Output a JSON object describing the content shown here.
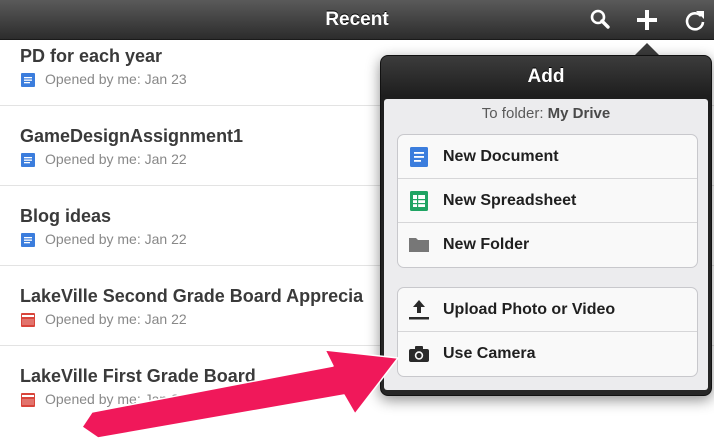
{
  "header": {
    "title": "Recent",
    "buttons": [
      {
        "name": "search-icon"
      },
      {
        "name": "plus-icon"
      },
      {
        "name": "refresh-icon"
      }
    ]
  },
  "documents": [
    {
      "title": "PD for each year",
      "meta": "Opened by me: Jan 23",
      "type": "document",
      "color": "#3b7ddd"
    },
    {
      "title": "GameDesignAssignment1",
      "meta": "Opened by me: Jan 22",
      "type": "document",
      "color": "#3b7ddd"
    },
    {
      "title": "Blog ideas",
      "meta": "Opened by me: Jan 22",
      "type": "document",
      "color": "#3b7ddd"
    },
    {
      "title": "LakeVille Second Grade Board Apprecia",
      "meta": "Opened by me: Jan 22",
      "type": "video",
      "color": "#d9453b"
    },
    {
      "title": "LakeVille First Grade Board",
      "meta": "Opened by me: Jan 22",
      "type": "video",
      "color": "#d9453b"
    }
  ],
  "popover": {
    "title": "Add",
    "folder_prefix": "To folder:",
    "folder_name": "My Drive",
    "create_items": [
      {
        "label": "New Document",
        "icon": "document-icon",
        "color": "#3b7ddd"
      },
      {
        "label": "New Spreadsheet",
        "icon": "spreadsheet-icon",
        "color": "#1fa463"
      },
      {
        "label": "New Folder",
        "icon": "folder-icon",
        "color": "#777777"
      }
    ],
    "upload_items": [
      {
        "label": "Upload Photo or Video",
        "icon": "upload-icon"
      },
      {
        "label": "Use Camera",
        "icon": "camera-icon"
      }
    ]
  },
  "annotation": {
    "color": "#f0185a",
    "icon": "annotation-arrow"
  }
}
